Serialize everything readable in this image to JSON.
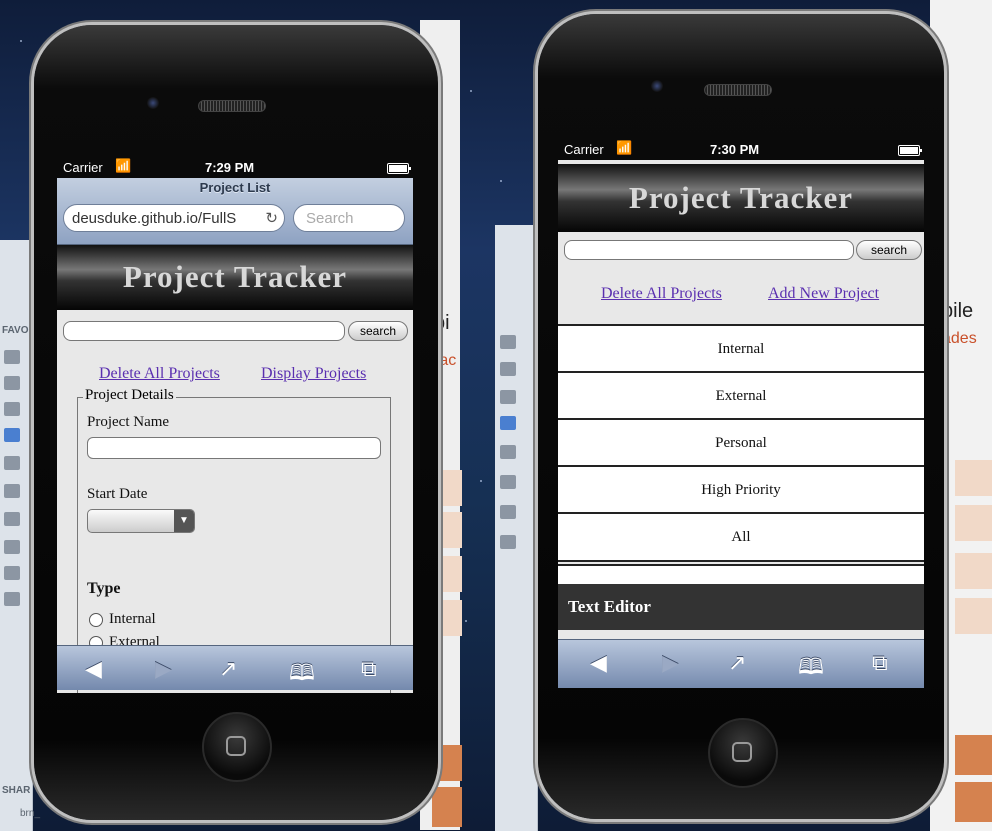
{
  "left_phone": {
    "status": {
      "carrier": "Carrier",
      "wifi_icon": "wifi-icon",
      "time": "7:29 PM"
    },
    "safari": {
      "page_title": "Project List",
      "url": "deusduke.github.io/FullS",
      "search_placeholder": "Search"
    },
    "header": "Project Tracker",
    "search_button": "search",
    "links": {
      "delete_all": "Delete All Projects",
      "display": "Display Projects"
    },
    "form": {
      "legend": "Project Details",
      "project_name_label": "Project Name",
      "start_date_label": "Start Date",
      "type_label": "Type",
      "radio_internal": "Internal",
      "radio_external": "External"
    }
  },
  "right_phone": {
    "status": {
      "carrier": "Carrier",
      "wifi_icon": "wifi-icon",
      "time": "7:30 PM"
    },
    "header": "Project Tracker",
    "search_button": "search",
    "links": {
      "delete_all": "Delete All Projects",
      "add_new": "Add New Project"
    },
    "list": [
      "Internal",
      "External",
      "Personal",
      "High Priority",
      "All"
    ],
    "text_editor": "Text Editor"
  },
  "toolbar_icons": [
    "back-arrow-icon",
    "forward-arrow-icon",
    "share-icon",
    "bookmarks-icon",
    "tabs-icon"
  ],
  "background": {
    "sidebar_labels": {
      "favorites": "FAVO",
      "shared": "SHAR",
      "device": "brn_"
    },
    "right_window_text": {
      "title_left": "bi",
      "sub_left": "rac",
      "title_right": "bile",
      "sub_right": "ades"
    }
  }
}
